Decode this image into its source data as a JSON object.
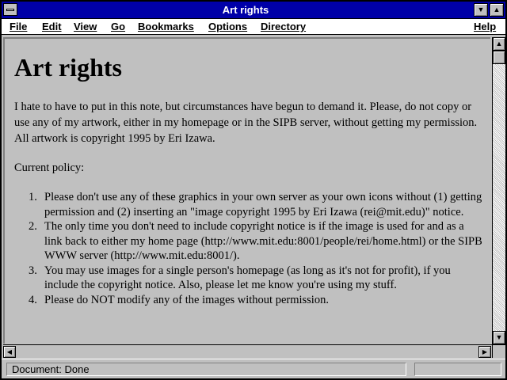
{
  "window": {
    "title": "Art rights"
  },
  "menubar": {
    "items": [
      {
        "label": "File"
      },
      {
        "label": "Edit"
      },
      {
        "label": "View"
      },
      {
        "label": "Go"
      },
      {
        "label": "Bookmarks"
      },
      {
        "label": "Options"
      },
      {
        "label": "Directory"
      },
      {
        "label": "Help"
      }
    ]
  },
  "page": {
    "heading": "Art rights",
    "intro": "I hate to have to put in this note, but circumstances have begun to demand it. Please, do not copy or use any of my artwork, either in my homepage or in the SIPB server, without getting my permission. All artwork is copyright 1995 by Eri Izawa.",
    "policy_label": "Current policy:",
    "policy_items": [
      {
        "number": "1.",
        "text": "Please don't use any of these graphics in your own server as your own icons without (1) getting permission and (2) inserting an \"image copyright 1995 by Eri Izawa (rei@mit.edu)\" notice."
      },
      {
        "number": "2.",
        "text": "The only time you don't need to include copyright notice is if the image is used for and as a link back to either my home page (http://www.mit.edu:8001/people/rei/home.html) or the SIPB WWW server (http://www.mit.edu:8001/)."
      },
      {
        "number": "3.",
        "text": "You may use images for a single person's homepage (as long as it's not for profit), if you include the copyright notice. Also, please let me know you're using my stuff."
      },
      {
        "number": "4.",
        "text": "Please do NOT modify any of the images without permission."
      }
    ]
  },
  "statusbar": {
    "text": "Document: Done"
  },
  "icons": {
    "system_menu": "system-menu-icon",
    "minimize": "triangle-down-icon",
    "maximize": "triangle-up-icon",
    "scroll_up": "arrow-up-icon",
    "scroll_down": "arrow-down-icon",
    "scroll_left": "arrow-left-icon",
    "scroll_right": "arrow-right-icon"
  },
  "colors": {
    "titlebar": "#0000a8",
    "chrome": "#c0c0c0"
  }
}
